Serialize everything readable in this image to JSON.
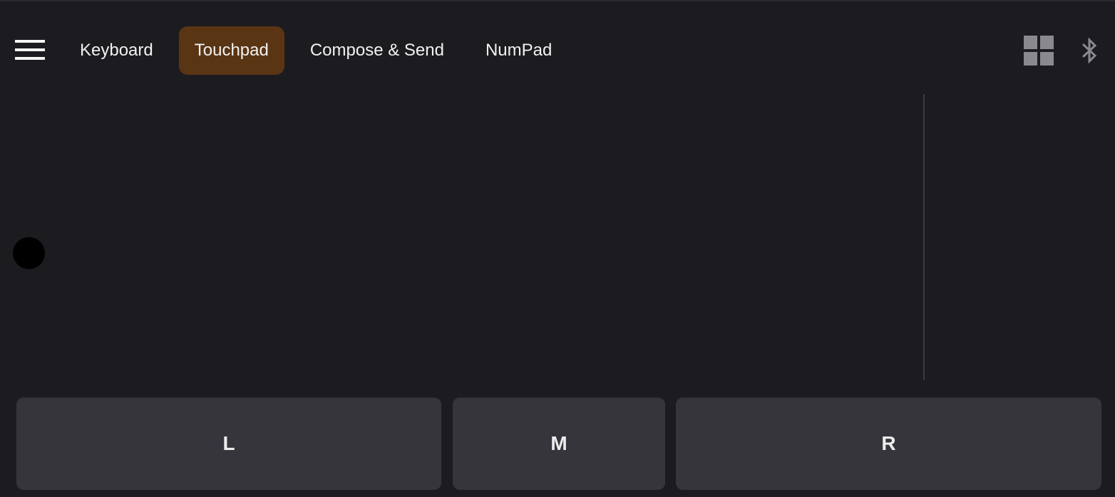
{
  "tabs": [
    {
      "label": "Keyboard",
      "active": false
    },
    {
      "label": "Touchpad",
      "active": true
    },
    {
      "label": "Compose & Send",
      "active": false
    },
    {
      "label": "NumPad",
      "active": false
    }
  ],
  "icons": {
    "menu": "hamburger-menu-icon",
    "layout": "grid-icon",
    "connection": "bluetooth-icon"
  },
  "mouse_buttons": {
    "left": "L",
    "middle": "M",
    "right": "R"
  },
  "colors": {
    "background": "#1c1b1f",
    "active_tab": "#5a3514",
    "button": "#36353c",
    "icon_gray": "#8a8a8e"
  }
}
